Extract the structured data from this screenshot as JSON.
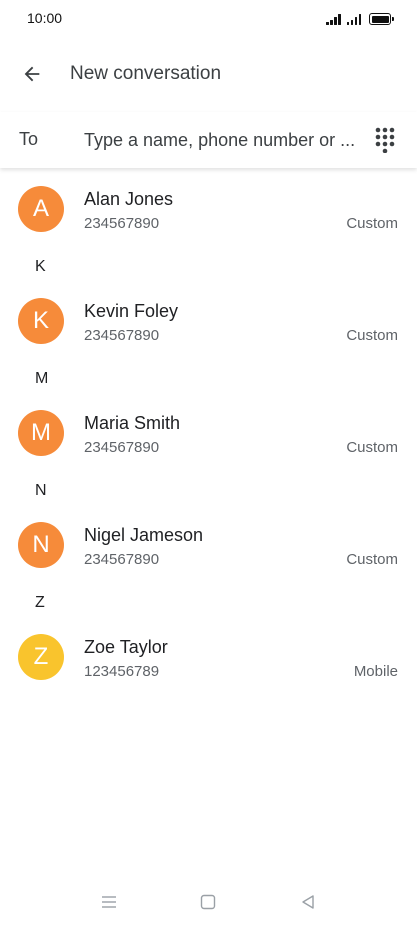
{
  "status_bar": {
    "time": "10:00"
  },
  "app_bar": {
    "title": "New conversation",
    "back_icon": "arrow-back-icon"
  },
  "recipient": {
    "label": "To",
    "placeholder": "Type a name, phone number or ...",
    "value": "",
    "dialpad_icon": "dialpad-icon"
  },
  "contacts": {
    "item_0": {
      "initial": "A",
      "name": "Alan Jones",
      "number": "234567890",
      "type": "Custom",
      "avatar_color": "#F68B3A"
    },
    "section_k": "K",
    "item_1": {
      "initial": "K",
      "name": "Kevin Foley",
      "number": "234567890",
      "type": "Custom",
      "avatar_color": "#F68B3A"
    },
    "section_m": "M",
    "item_2": {
      "initial": "M",
      "name": "Maria Smith",
      "number": "234567890",
      "type": "Custom",
      "avatar_color": "#F68B3A"
    },
    "section_n": "N",
    "item_3": {
      "initial": "N",
      "name": "Nigel Jameson",
      "number": "234567890",
      "type": "Custom",
      "avatar_color": "#F68B3A"
    },
    "section_z": "Z",
    "item_4": {
      "initial": "Z",
      "name": "Zoe Taylor",
      "number": "123456789",
      "type": "Mobile",
      "avatar_color": "#F9C42D"
    }
  },
  "nav_bar": {
    "menu_icon": "menu-icon",
    "home_icon": "home-icon",
    "back_icon": "back-triangle-icon"
  },
  "colors": {
    "avatar_orange": "#F68B3A",
    "avatar_yellow": "#F9C42D",
    "text_primary": "#202124",
    "text_secondary": "#5f6368"
  }
}
